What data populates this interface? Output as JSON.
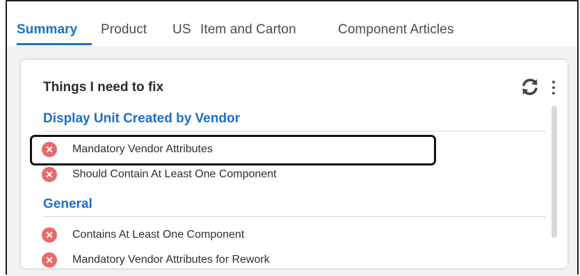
{
  "tabs": [
    {
      "label": "Summary",
      "active": true
    },
    {
      "label": "Product",
      "active": false
    },
    {
      "label": "US",
      "active": false
    },
    {
      "label": "Item and Carton",
      "active": false
    },
    {
      "label": "Component Articles",
      "active": false
    }
  ],
  "card": {
    "title": "Things I need to fix",
    "refresh_icon": "refresh-icon",
    "more_icon": "vertical-ellipsis-icon",
    "sections": [
      {
        "title": "Display Unit Created by Vendor",
        "items": [
          {
            "label": "Mandatory Vendor Attributes",
            "icon": "error-x-icon"
          },
          {
            "label": "Should Contain At Least One Component",
            "icon": "error-x-icon"
          }
        ]
      },
      {
        "title": "General",
        "items": [
          {
            "label": "Contains At Least One Component",
            "icon": "error-x-icon"
          },
          {
            "label": "Mandatory Vendor Attributes for Rework",
            "icon": "error-x-icon"
          }
        ]
      }
    ]
  },
  "colors": {
    "accent": "#1b6fc8",
    "error": "#e96a6a",
    "background": "#f2f2f2"
  }
}
